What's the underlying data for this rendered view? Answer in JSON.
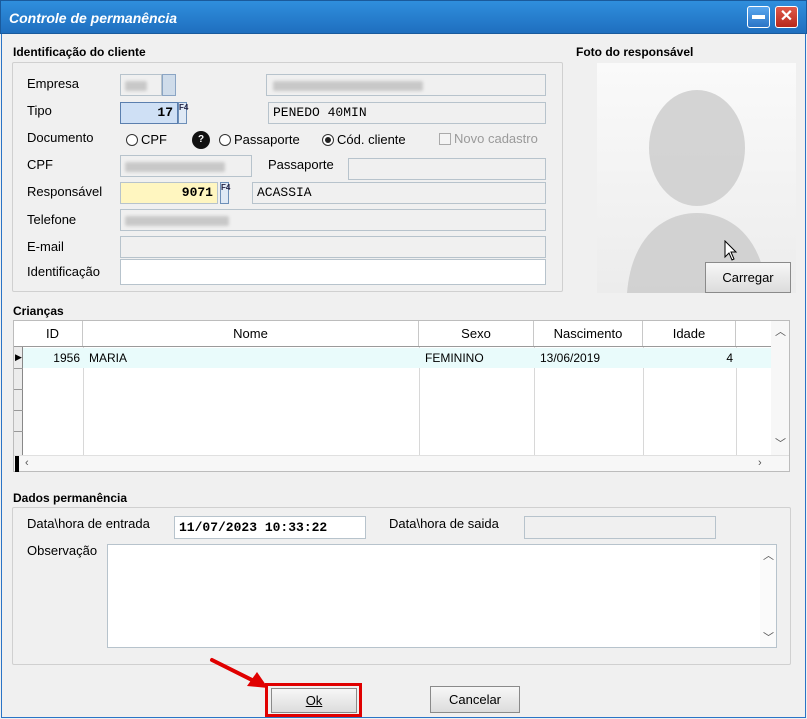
{
  "window": {
    "title": "Controle de permanência",
    "close_glyph": "✕"
  },
  "client": {
    "section_title": "Identificação do cliente",
    "labels": {
      "empresa": "Empresa",
      "tipo": "Tipo",
      "documento": "Documento",
      "cpf": "CPF",
      "passaporte": "Passaporte",
      "responsavel": "Responsável",
      "telefone": "Telefone",
      "email": "E-mail",
      "identificacao": "Identificação"
    },
    "tipo_code": "17",
    "tipo_name": "PENEDO 40MIN",
    "documento_options": {
      "cpf": "CPF",
      "passaporte": "Passaporte",
      "cod_cliente": "Cód. cliente",
      "selected": "Cód. cliente"
    },
    "novo_cadastro_label": "Novo cadastro",
    "responsavel_code": "9071",
    "responsavel_name": "ACASSIA",
    "f4_label": "F4",
    "help_glyph": "?"
  },
  "photo": {
    "section_title": "Foto do responsável",
    "load_button": "Carregar"
  },
  "children": {
    "section_title": "Crianças",
    "columns": [
      "ID",
      "Nome",
      "Sexo",
      "Nascimento",
      "Idade"
    ],
    "rows": [
      {
        "id": "1956",
        "nome": "MARIA",
        "sexo": "FEMININO",
        "nascimento": "13/06/2019",
        "idade": "4"
      }
    ]
  },
  "stay": {
    "section_title": "Dados permanência",
    "entrada_label": "Data\\hora de entrada",
    "entrada_value": "11/07/2023 10:33:22",
    "saida_label": "Data\\hora de saida",
    "observacao_label": "Observação"
  },
  "buttons": {
    "ok": "Ok",
    "cancel": "Cancelar"
  },
  "colors": {
    "title_bar": "#1f6fbf",
    "highlight": "#e00000",
    "responsavel_field": "#fff6c0"
  }
}
